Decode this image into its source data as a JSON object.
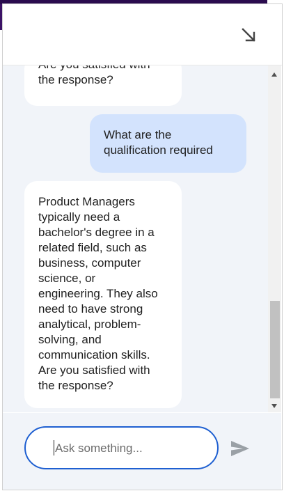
{
  "chat": {
    "messages": [
      {
        "role": "bot",
        "lines": [
          "Are you satisfied with",
          "the response?"
        ]
      },
      {
        "role": "user",
        "lines": [
          "What are the",
          "qualification required"
        ]
      },
      {
        "role": "bot",
        "lines": [
          "Product Managers",
          "typically need a",
          "bachelor's degree in a",
          "related field, such as",
          "business, computer",
          "science, or",
          "engineering. They also",
          "need to have strong",
          "analytical, problem-",
          "solving, and",
          "communication skills.",
          "Are you satisfied with",
          "the response?"
        ]
      }
    ]
  },
  "composer": {
    "placeholder": "Ask something..."
  },
  "colors": {
    "accent": "#1e5fd1",
    "user_bubble": "#d3e3fd",
    "chat_background": "#f1f4f9"
  },
  "icons": {
    "minimize": "arrow-down-right-icon",
    "send": "send-icon"
  }
}
